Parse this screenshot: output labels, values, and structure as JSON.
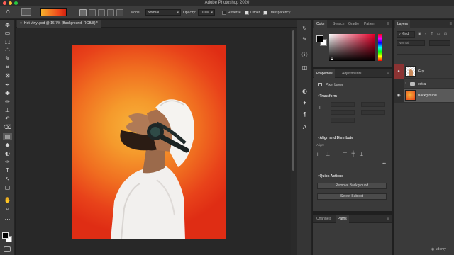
{
  "window": {
    "title": "Adobe Photoshop 2020",
    "traffic_lights": [
      "#ff5f57",
      "#febc2e",
      "#28c840"
    ]
  },
  "options_bar": {
    "mode_label": "Mode:",
    "mode_value": "Normal",
    "opacity_label": "Opacity:",
    "opacity_value": "100%",
    "reverse_label": "Reverse",
    "dither_label": "Dither",
    "transparency_label": "Transparency",
    "reverse_checked": false,
    "dither_checked": true,
    "transparency_checked": true
  },
  "document": {
    "tab_title": "Hot Vinyl.psd @ 16.7% (Background, RGB/8) *",
    "close_glyph": "×"
  },
  "tools": [
    "move-tool-icon",
    "artboard-tool-icon",
    "marquee-tool-icon",
    "lasso-tool-icon",
    "quick-select-tool-icon",
    "crop-tool-icon",
    "frame-tool-icon",
    "eyedropper-tool-icon",
    "healing-brush-tool-icon",
    "brush-tool-icon",
    "clone-stamp-tool-icon",
    "history-brush-tool-icon",
    "eraser-tool-icon",
    "gradient-tool-icon",
    "blur-tool-icon",
    "dodge-tool-icon",
    "pen-tool-icon",
    "type-tool-icon",
    "path-select-tool-icon",
    "rectangle-tool-icon",
    "hand-tool-icon",
    "zoom-tool-icon",
    "more-tools-icon"
  ],
  "tool_glyphs": [
    "✥",
    "▭",
    "⬚",
    "◌",
    "✎",
    "⌗",
    "⊠",
    "✒",
    "✚",
    "✏",
    "⊥",
    "↶",
    "⌫",
    "▤",
    "◆",
    "◐",
    "✑",
    "T",
    "↖",
    "▢",
    "✋",
    "⌕",
    "…"
  ],
  "color_panel": {
    "tabs": [
      "Color",
      "Swatch",
      "Gradie",
      "Pattern"
    ],
    "foreground": "#000000",
    "background": "#ffffff"
  },
  "properties_panel": {
    "tabs": [
      "Properties",
      "Adjustments"
    ],
    "layer_type": "Pixel Layer",
    "transform_label": "Transform",
    "align_label": "Align and Distribute",
    "align_sub": "Align:",
    "quick_actions_label": "Quick Actions",
    "remove_bg_label": "Remove Background",
    "select_subject_label": "Select Subject"
  },
  "bottom_panel": {
    "tabs": [
      "Channels",
      "Paths"
    ]
  },
  "layers_panel": {
    "tab": "Layers",
    "search_kind": "Kind",
    "blend_mode": "Normal",
    "layers": [
      {
        "name": "Guy",
        "visible": true
      },
      {
        "name": "extra",
        "visible": false,
        "folder": true
      },
      {
        "name": "Background",
        "visible": true
      }
    ]
  },
  "watermark": "udemy"
}
